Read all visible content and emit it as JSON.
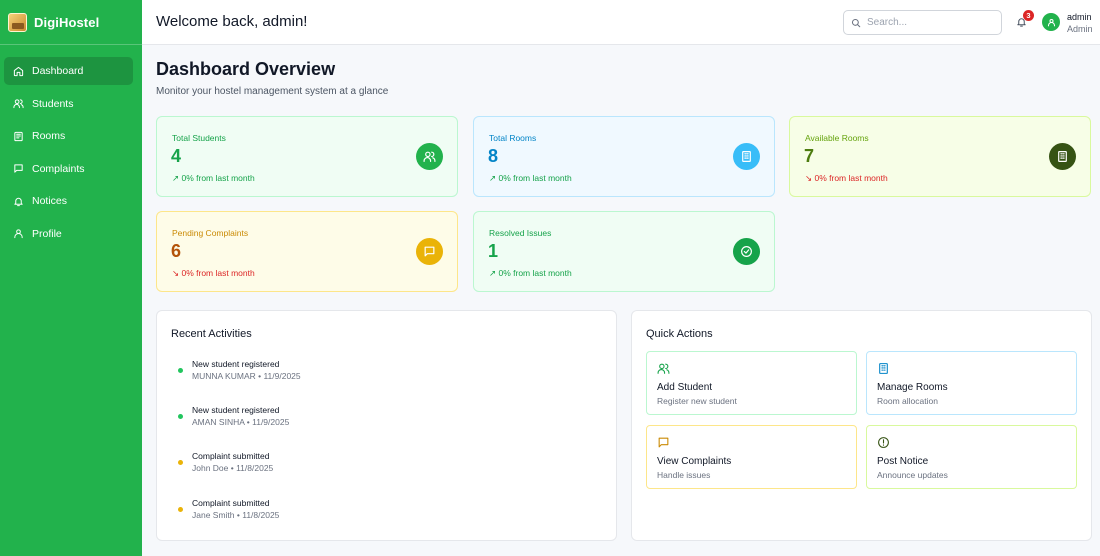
{
  "brand": {
    "name": "DigiHostel"
  },
  "sidebar": {
    "items": [
      {
        "label": "Dashboard",
        "icon": "home-icon",
        "active": true
      },
      {
        "label": "Students",
        "icon": "users-icon"
      },
      {
        "label": "Rooms",
        "icon": "book-icon"
      },
      {
        "label": "Complaints",
        "icon": "message-icon"
      },
      {
        "label": "Notices",
        "icon": "bell-icon"
      },
      {
        "label": "Profile",
        "icon": "user-icon"
      }
    ]
  },
  "header": {
    "welcome": "Welcome back, admin!",
    "search_placeholder": "Search...",
    "notification_count": "3",
    "user_name": "admin",
    "user_role": "Admin"
  },
  "main": {
    "title": "Dashboard Overview",
    "subtitle": "Monitor your hostel management system at a glance"
  },
  "stats": [
    {
      "label": "Total Students",
      "value": "4",
      "trend": "↗ 0% from last month",
      "icon": "users-icon"
    },
    {
      "label": "Total Rooms",
      "value": "8",
      "trend": "↗ 0% from last month",
      "icon": "building-icon"
    },
    {
      "label": "Available Rooms",
      "value": "7",
      "trend": "↘ 0% from last month",
      "icon": "building-icon"
    },
    {
      "label": "Pending Complaints",
      "value": "6",
      "trend": "↘ 0% from last month",
      "icon": "message-icon"
    },
    {
      "label": "Resolved Issues",
      "value": "1",
      "trend": "↗ 0% from last month",
      "icon": "check-circle-icon"
    }
  ],
  "activities": {
    "title": "Recent Activities",
    "items": [
      {
        "title": "New student registered",
        "meta": "MUNNA KUMAR • 11/9/2025"
      },
      {
        "title": "New student registered",
        "meta": "AMAN SINHA • 11/9/2025"
      },
      {
        "title": "Complaint submitted",
        "meta": "John Doe • 11/8/2025"
      },
      {
        "title": "Complaint submitted",
        "meta": "Jane Smith • 11/8/2025"
      }
    ]
  },
  "quick_actions": {
    "title": "Quick Actions",
    "items": [
      {
        "name": "Add Student",
        "desc": "Register new student",
        "icon": "users-icon"
      },
      {
        "name": "Manage Rooms",
        "desc": "Room allocation",
        "icon": "building-icon"
      },
      {
        "name": "View Complaints",
        "desc": "Handle issues",
        "icon": "message-icon"
      },
      {
        "name": "Post Notice",
        "desc": "Announce updates",
        "icon": "alert-circle-icon"
      }
    ]
  },
  "colors": {
    "sidebar": "#22b24c",
    "sidebar_active": "#1d9440",
    "green": "#16a34a",
    "blue": "#0284c7",
    "olive": "#65a30d",
    "amber": "#ca8a04",
    "red": "#dc2626"
  }
}
